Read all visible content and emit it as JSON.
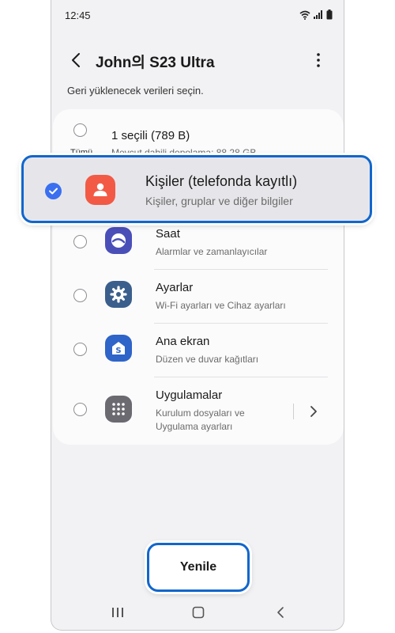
{
  "status_bar": {
    "time": "12:45",
    "icons": [
      "wifi-icon",
      "signal-icon",
      "battery-icon"
    ]
  },
  "header": {
    "title": "John의 S23 Ultra",
    "back_icon": "chevron-left-icon",
    "more_icon": "more-vertical-icon"
  },
  "subtitle": "Geri yüklenecek verileri seçin.",
  "select_all": {
    "label": "Tümü",
    "title": "1 seçili (789 B)",
    "subtitle": "Mevcut dahili depolama: 88,28 GB",
    "checked": false
  },
  "highlighted_item": {
    "title": "Kişiler (telefonda kayıtlı)",
    "subtitle": "Kişiler, gruplar ve diğer bilgiler",
    "checked": true,
    "icon": "contact-icon",
    "icon_color": "#f25a45"
  },
  "items": [
    {
      "title": "Saat",
      "subtitle": "Alarmlar ve zamanlayıcılar",
      "icon": "clock-icon",
      "icon_color": "#4a4fb8",
      "checked": false
    },
    {
      "title": "Ayarlar",
      "subtitle": "Wi-Fi ayarları ve Cihaz ayarları",
      "icon": "gear-icon",
      "icon_color": "#3b5f8c",
      "checked": false
    },
    {
      "title": "Ana ekran",
      "subtitle": "Düzen ve duvar kağıtları",
      "icon": "home-screen-icon",
      "icon_color": "#2f64c8",
      "checked": false
    },
    {
      "title": "Uygulamalar",
      "subtitle": "Kurulum dosyaları ve Uygulama ayarları",
      "icon": "apps-grid-icon",
      "icon_color": "#6a6a70",
      "checked": false
    }
  ],
  "refresh_button": {
    "label": "Yenile"
  },
  "navbar": [
    "recents-icon",
    "home-icon",
    "back-icon"
  ],
  "colors": {
    "highlight_border": "#1166cc",
    "checkbox": "#3a6ff0",
    "background": "#f2f2f4"
  }
}
